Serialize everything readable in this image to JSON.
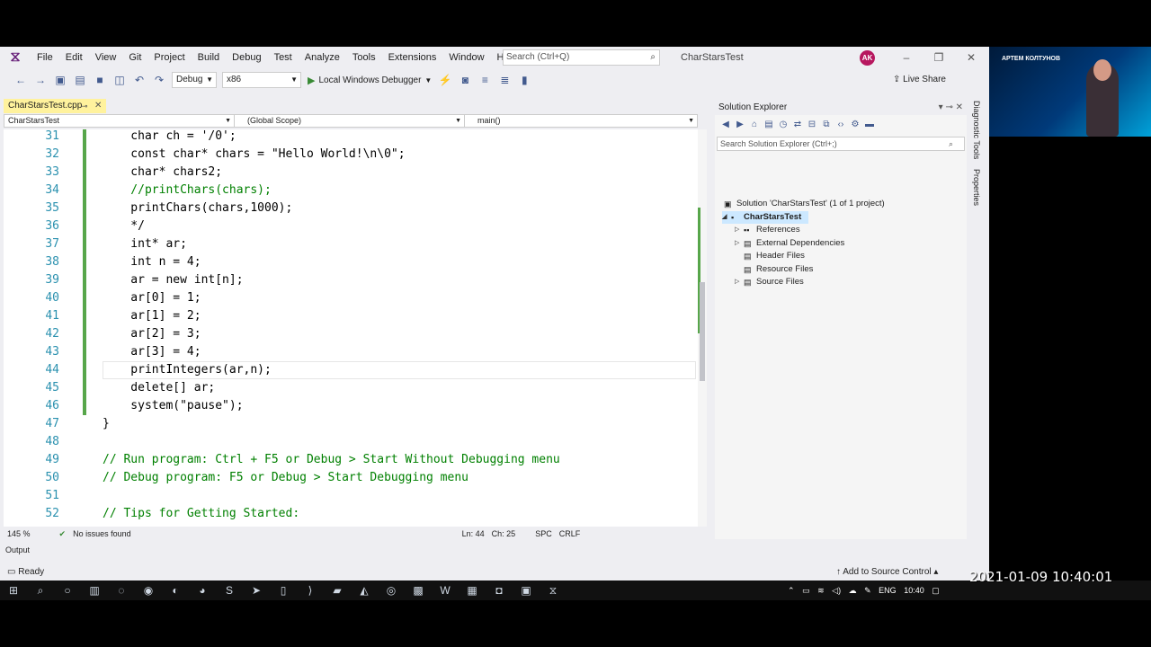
{
  "window": {
    "menus": [
      "File",
      "Edit",
      "View",
      "Git",
      "Project",
      "Build",
      "Debug",
      "Test",
      "Analyze",
      "Tools",
      "Extensions",
      "Window",
      "Help"
    ],
    "search_placeholder": "Search (Ctrl+Q)",
    "solution_name": "CharStarsTest",
    "avatar": "AK"
  },
  "toolbar": {
    "config": "Debug",
    "platform": "x86",
    "run_label": "Local Windows Debugger",
    "live_share": "Live Share"
  },
  "tab": {
    "name": "CharStarsTest.cpp"
  },
  "nav": {
    "project": "CharStarsTest",
    "scope": "(Global Scope)",
    "member": "main()"
  },
  "code_lines": [
    {
      "n": "31",
      "t": "    char ch = '/0';"
    },
    {
      "n": "32",
      "t": "    const char* chars = \"Hello World!\\n\\0\";"
    },
    {
      "n": "33",
      "t": "    char* chars2;"
    },
    {
      "n": "34",
      "t": "    //printChars(chars);"
    },
    {
      "n": "35",
      "t": "    printChars(chars,1000);"
    },
    {
      "n": "36",
      "t": "    */"
    },
    {
      "n": "37",
      "t": "    int* ar;"
    },
    {
      "n": "38",
      "t": "    int n = 4;"
    },
    {
      "n": "39",
      "t": "    ar = new int[n];"
    },
    {
      "n": "40",
      "t": "    ar[0] = 1;"
    },
    {
      "n": "41",
      "t": "    ar[1] = 2;"
    },
    {
      "n": "42",
      "t": "    ar[2] = 3;"
    },
    {
      "n": "43",
      "t": "    ar[3] = 4;"
    },
    {
      "n": "44",
      "t": "    printIntegers(ar,n);"
    },
    {
      "n": "45",
      "t": "    delete[] ar;"
    },
    {
      "n": "46",
      "t": "    system(\"pause\");"
    },
    {
      "n": "47",
      "t": "}"
    },
    {
      "n": "48",
      "t": ""
    },
    {
      "n": "49",
      "t": "// Run program: Ctrl + F5 or Debug > Start Without Debugging menu"
    },
    {
      "n": "50",
      "t": "// Debug program: F5 or Debug > Start Debugging menu"
    },
    {
      "n": "51",
      "t": ""
    },
    {
      "n": "52",
      "t": "// Tips for Getting Started:"
    }
  ],
  "editor_status": {
    "zoom": "145 %",
    "issues": "No issues found",
    "line": "Ln: 44",
    "col": "Ch: 25",
    "spc": "SPC",
    "eol": "CRLF"
  },
  "solution_explorer": {
    "title": "Solution Explorer",
    "search_placeholder": "Search Solution Explorer (Ctrl+;)",
    "solution_line": "Solution 'CharStarsTest' (1 of 1 project)",
    "project": "CharStarsTest",
    "items": [
      "References",
      "External Dependencies",
      "Header Files",
      "Resource Files",
      "Source Files"
    ]
  },
  "side_tabs": [
    "Diagnostic Tools",
    "Properties"
  ],
  "output_tab": "Output",
  "status": {
    "ready": "Ready",
    "source_control": "Add to Source Control"
  },
  "webcam": {
    "name": "АРТЕМ КОЛТУНОВ"
  },
  "tray": {
    "lang": "ENG",
    "time": "10:40"
  },
  "overlay_timestamp": "2021-01-09 10:40:01",
  "colors": {
    "accent": "#68217a",
    "run_green": "#388a34",
    "line_number": "#2b91af",
    "active_tab": "#fff29d"
  }
}
